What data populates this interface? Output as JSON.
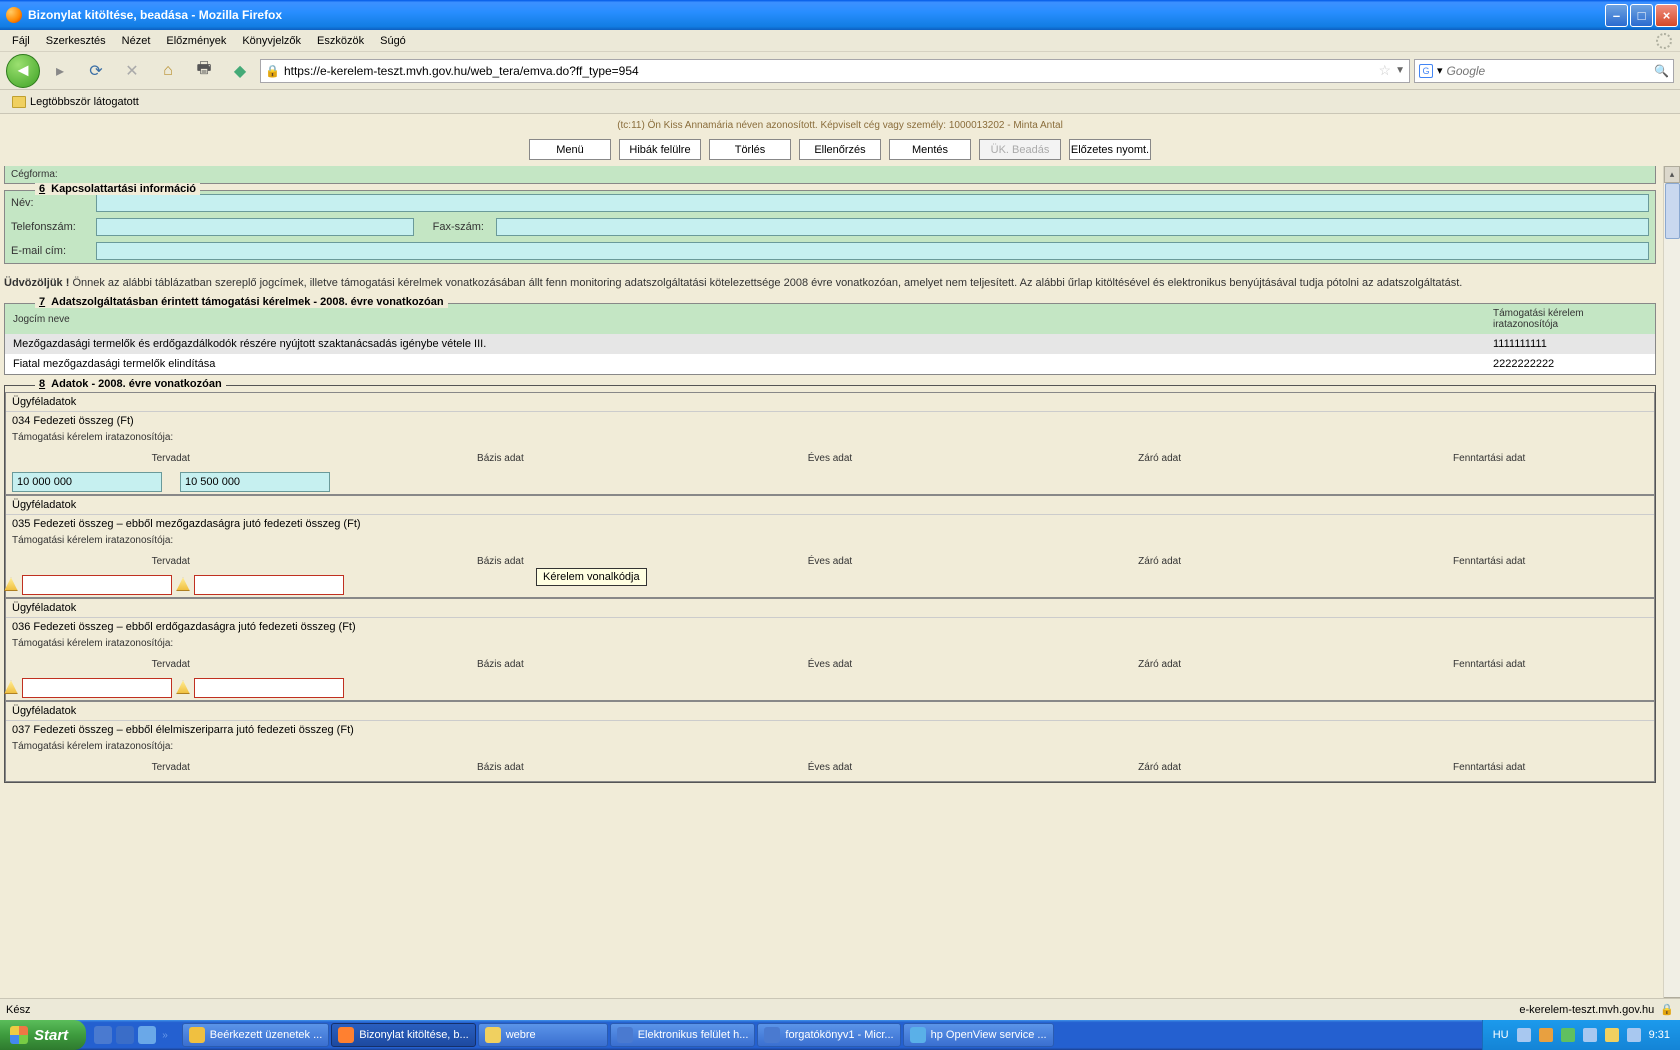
{
  "window": {
    "title": "Bizonylat kitöltése, beadása - Mozilla Firefox"
  },
  "menu": {
    "file": "Fájl",
    "edit": "Szerkesztés",
    "view": "Nézet",
    "history": "Előzmények",
    "bookmarks": "Könyvjelzők",
    "tools": "Eszközök",
    "help": "Súgó"
  },
  "url": "https://e-kerelem-teszt.mvh.gov.hu/web_tera/emva.do?ff_type=954",
  "search_placeholder": "Google",
  "bookmark": "Legtöbbször látogatott",
  "userinfo": "(tc:11) Ön Kiss Annamária néven azonosított.  Képviselt cég vagy személy: 1000013202 - Minta Antal",
  "buttons": {
    "menu": "Menü",
    "errors": "Hibák felülre",
    "delete": "Törlés",
    "check": "Ellenőrzés",
    "save": "Mentés",
    "submit": "ÜK. Beadás",
    "preview": "Előzetes nyomt."
  },
  "cegforma_label": "Cégforma:",
  "sec6": {
    "num": "6",
    "title": "Kapcsolattartási információ",
    "name": "Név:",
    "phone": "Telefonszám:",
    "fax": "Fax-szám:",
    "email": "E-mail cím:"
  },
  "welcome1": "Üdvözöljük !",
  "welcome2": "Önnek az alábbi táblázatban szereplő jogcímek, illetve támogatási kérelmek vonatkozásában állt fenn monitoring adatszolgáltatási kötelezettsége 2008 évre vonatkozóan, amelyet nem teljesített. Az alábbi űrlap kitöltésével és elektronikus benyújtásával tudja pótolni az adatszolgáltatást.",
  "sec7": {
    "num": "7",
    "title": "Adatszolgáltatásban érintett támogatási kérelmek - 2008. évre vonatkozóan",
    "h1": "Jogcím neve",
    "h2": "Támogatási kérelem iratazonosítója",
    "r1c1": "Mezőgazdasági termelők és erdőgazdálkodók részére nyújtott szaktanácsadás igénybe vétele III.",
    "r1c2": "1111111111",
    "r2c1": "Fiatal mezőgazdasági termelők elindítása",
    "r2c2": "2222222222"
  },
  "sec8": {
    "num": "8",
    "title": "Adatok - 2008. évre vonatkozóan"
  },
  "cols": {
    "terv": "Tervadat",
    "bazis": "Bázis adat",
    "eves": "Éves adat",
    "zaro": "Záró adat",
    "fenn": "Fenntartási adat"
  },
  "ugyfel": "Ügyféladatok",
  "note": "Támogatási kérelem iratazonosítója:",
  "b034": {
    "t": "034  Fedezeti összeg (Ft)",
    "v1": "10 000 000",
    "v2": "10 500 000"
  },
  "b035": {
    "t": "035  Fedezeti összeg – ebből mezőgazdaságra jutó fedezeti összeg (Ft)"
  },
  "b036": {
    "t": "036  Fedezeti összeg – ebből erdőgazdaságra jutó fedezeti összeg (Ft)"
  },
  "b037": {
    "t": "037  Fedezeti összeg – ebből  élelmiszeriparra jutó fedezeti összeg (Ft)"
  },
  "tooltip": "Kérelem vonalkódja",
  "status": {
    "ready": "Kész",
    "domain": "e-kerelem-teszt.mvh.gov.hu"
  },
  "taskbar": {
    "start": "Start",
    "t1": "Beérkezett üzenetek ...",
    "t2": "Bizonylat kitöltése, b...",
    "t3": "webre",
    "t4": "Elektronikus felület h...",
    "t5": "forgatókönyv1 - Micr...",
    "t6": "hp OpenView service ...",
    "lang": "HU",
    "time": "9:31"
  }
}
